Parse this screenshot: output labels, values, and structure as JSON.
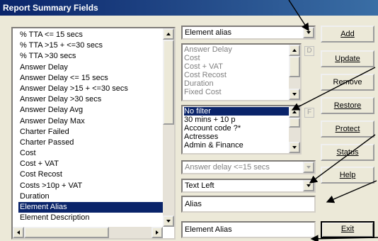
{
  "window": {
    "title": "Report Summary Fields"
  },
  "field_list": {
    "items": [
      "% TTA <= 15 secs",
      "% TTA >15 + <=30 secs",
      "% TTA >30 secs",
      "Answer Delay",
      "Answer Delay <= 15 secs",
      "Answer Delay >15 + <=30 secs",
      "Answer Delay >30 secs",
      "Answer Delay Avg",
      "Answer Delay Max",
      "Charter Failed",
      "Charter Passed",
      "Cost",
      "Cost + VAT",
      "Cost Recost",
      "Costs >10p + VAT",
      "Duration",
      "Element Alias",
      "Element Description"
    ],
    "selected": "Element Alias"
  },
  "element_combo": {
    "value": "Element alias"
  },
  "fields_list": {
    "items": [
      "Answer Delay",
      "Cost",
      "Cost + VAT",
      "Cost Recost",
      "Duration",
      "Fixed Cost"
    ],
    "button": "D"
  },
  "filter_list": {
    "items": [
      "No filter",
      "30 mins + 10 p",
      "Account code ?*",
      "Actresses",
      "Admin & Finance"
    ],
    "selected": "No filter",
    "button": "F"
  },
  "answer_combo": {
    "value": "Answer delay <=15 secs"
  },
  "align_combo": {
    "value": "Text Left"
  },
  "alias_field": {
    "value": "Alias"
  },
  "element_alias_field": {
    "value": "Element Alias"
  },
  "buttons": {
    "add": "Add",
    "update": "Update",
    "remove": "Remove",
    "restore": "Restore",
    "protect": "Protect",
    "status": "Status",
    "help": "Help",
    "exit": "Exit"
  }
}
